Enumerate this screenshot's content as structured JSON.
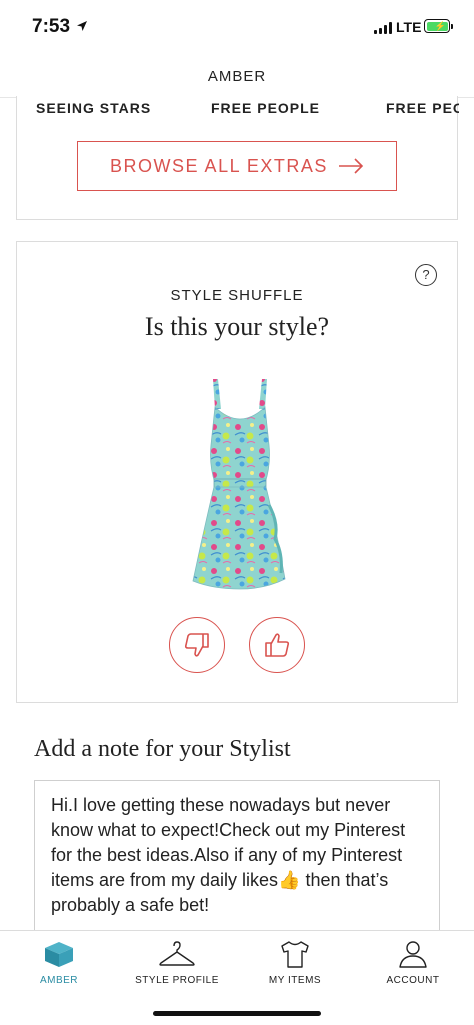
{
  "status_bar": {
    "time": "7:53",
    "network": "LTE",
    "icons": [
      "location-arrow-icon",
      "signal-icon",
      "battery-charging-icon"
    ]
  },
  "header": {
    "title": "AMBER"
  },
  "extras": {
    "brands": [
      "SEEING STARS",
      "FREE PEOPLE",
      "FREE PEO"
    ],
    "browse_label": "BROWSE ALL EXTRAS"
  },
  "style_shuffle": {
    "label": "STYLE SHUFFLE",
    "question": "Is this your style?",
    "help_icon": "?",
    "item_image": "dress-image"
  },
  "note": {
    "title": "Add a note for your Stylist",
    "text": "Hi.I love getting these nowadays but never know what to expect!Check out my Pinterest for the best ideas.Also if any of my Pinterest items are from my daily likes👍 then that’s probably a safe bet!"
  },
  "tabs": [
    {
      "label": "AMBER",
      "icon": "box-icon",
      "active": true
    },
    {
      "label": "STYLE PROFILE",
      "icon": "hanger-icon",
      "active": false
    },
    {
      "label": "MY ITEMS",
      "icon": "shirt-icon",
      "active": false
    },
    {
      "label": "ACCOUNT",
      "icon": "person-icon",
      "active": false
    }
  ],
  "colors": {
    "accent_red": "#d9534f",
    "active_tab": "#2a8ca3",
    "battery": "#4cd964"
  }
}
